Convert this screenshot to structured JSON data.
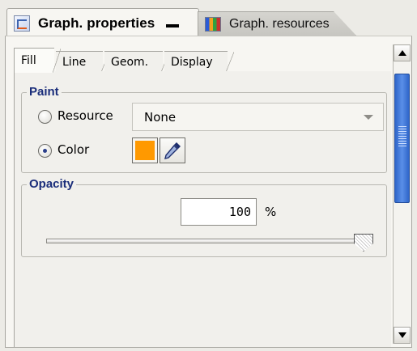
{
  "view_tabs": [
    {
      "label": "Graph. properties",
      "icon": "properties-icon",
      "active": true
    },
    {
      "label": "Graph. resources",
      "icon": "resources-icon",
      "active": false
    }
  ],
  "sub_tabs": [
    {
      "label": "Fill",
      "active": true
    },
    {
      "label": "Line",
      "active": false
    },
    {
      "label": "Geom.",
      "active": false
    },
    {
      "label": "Display",
      "active": false
    }
  ],
  "paint": {
    "title": "Paint",
    "resource_label": "Resource",
    "resource_value": "None",
    "color_label": "Color",
    "selected": "Color",
    "color_value": "#ff9900"
  },
  "opacity": {
    "title": "Opacity",
    "value": "100",
    "unit": "%",
    "slider_fraction": 1.0
  },
  "colors": {
    "group_title": "#1a2d7a",
    "scroll_thumb": "#3a72d6"
  }
}
